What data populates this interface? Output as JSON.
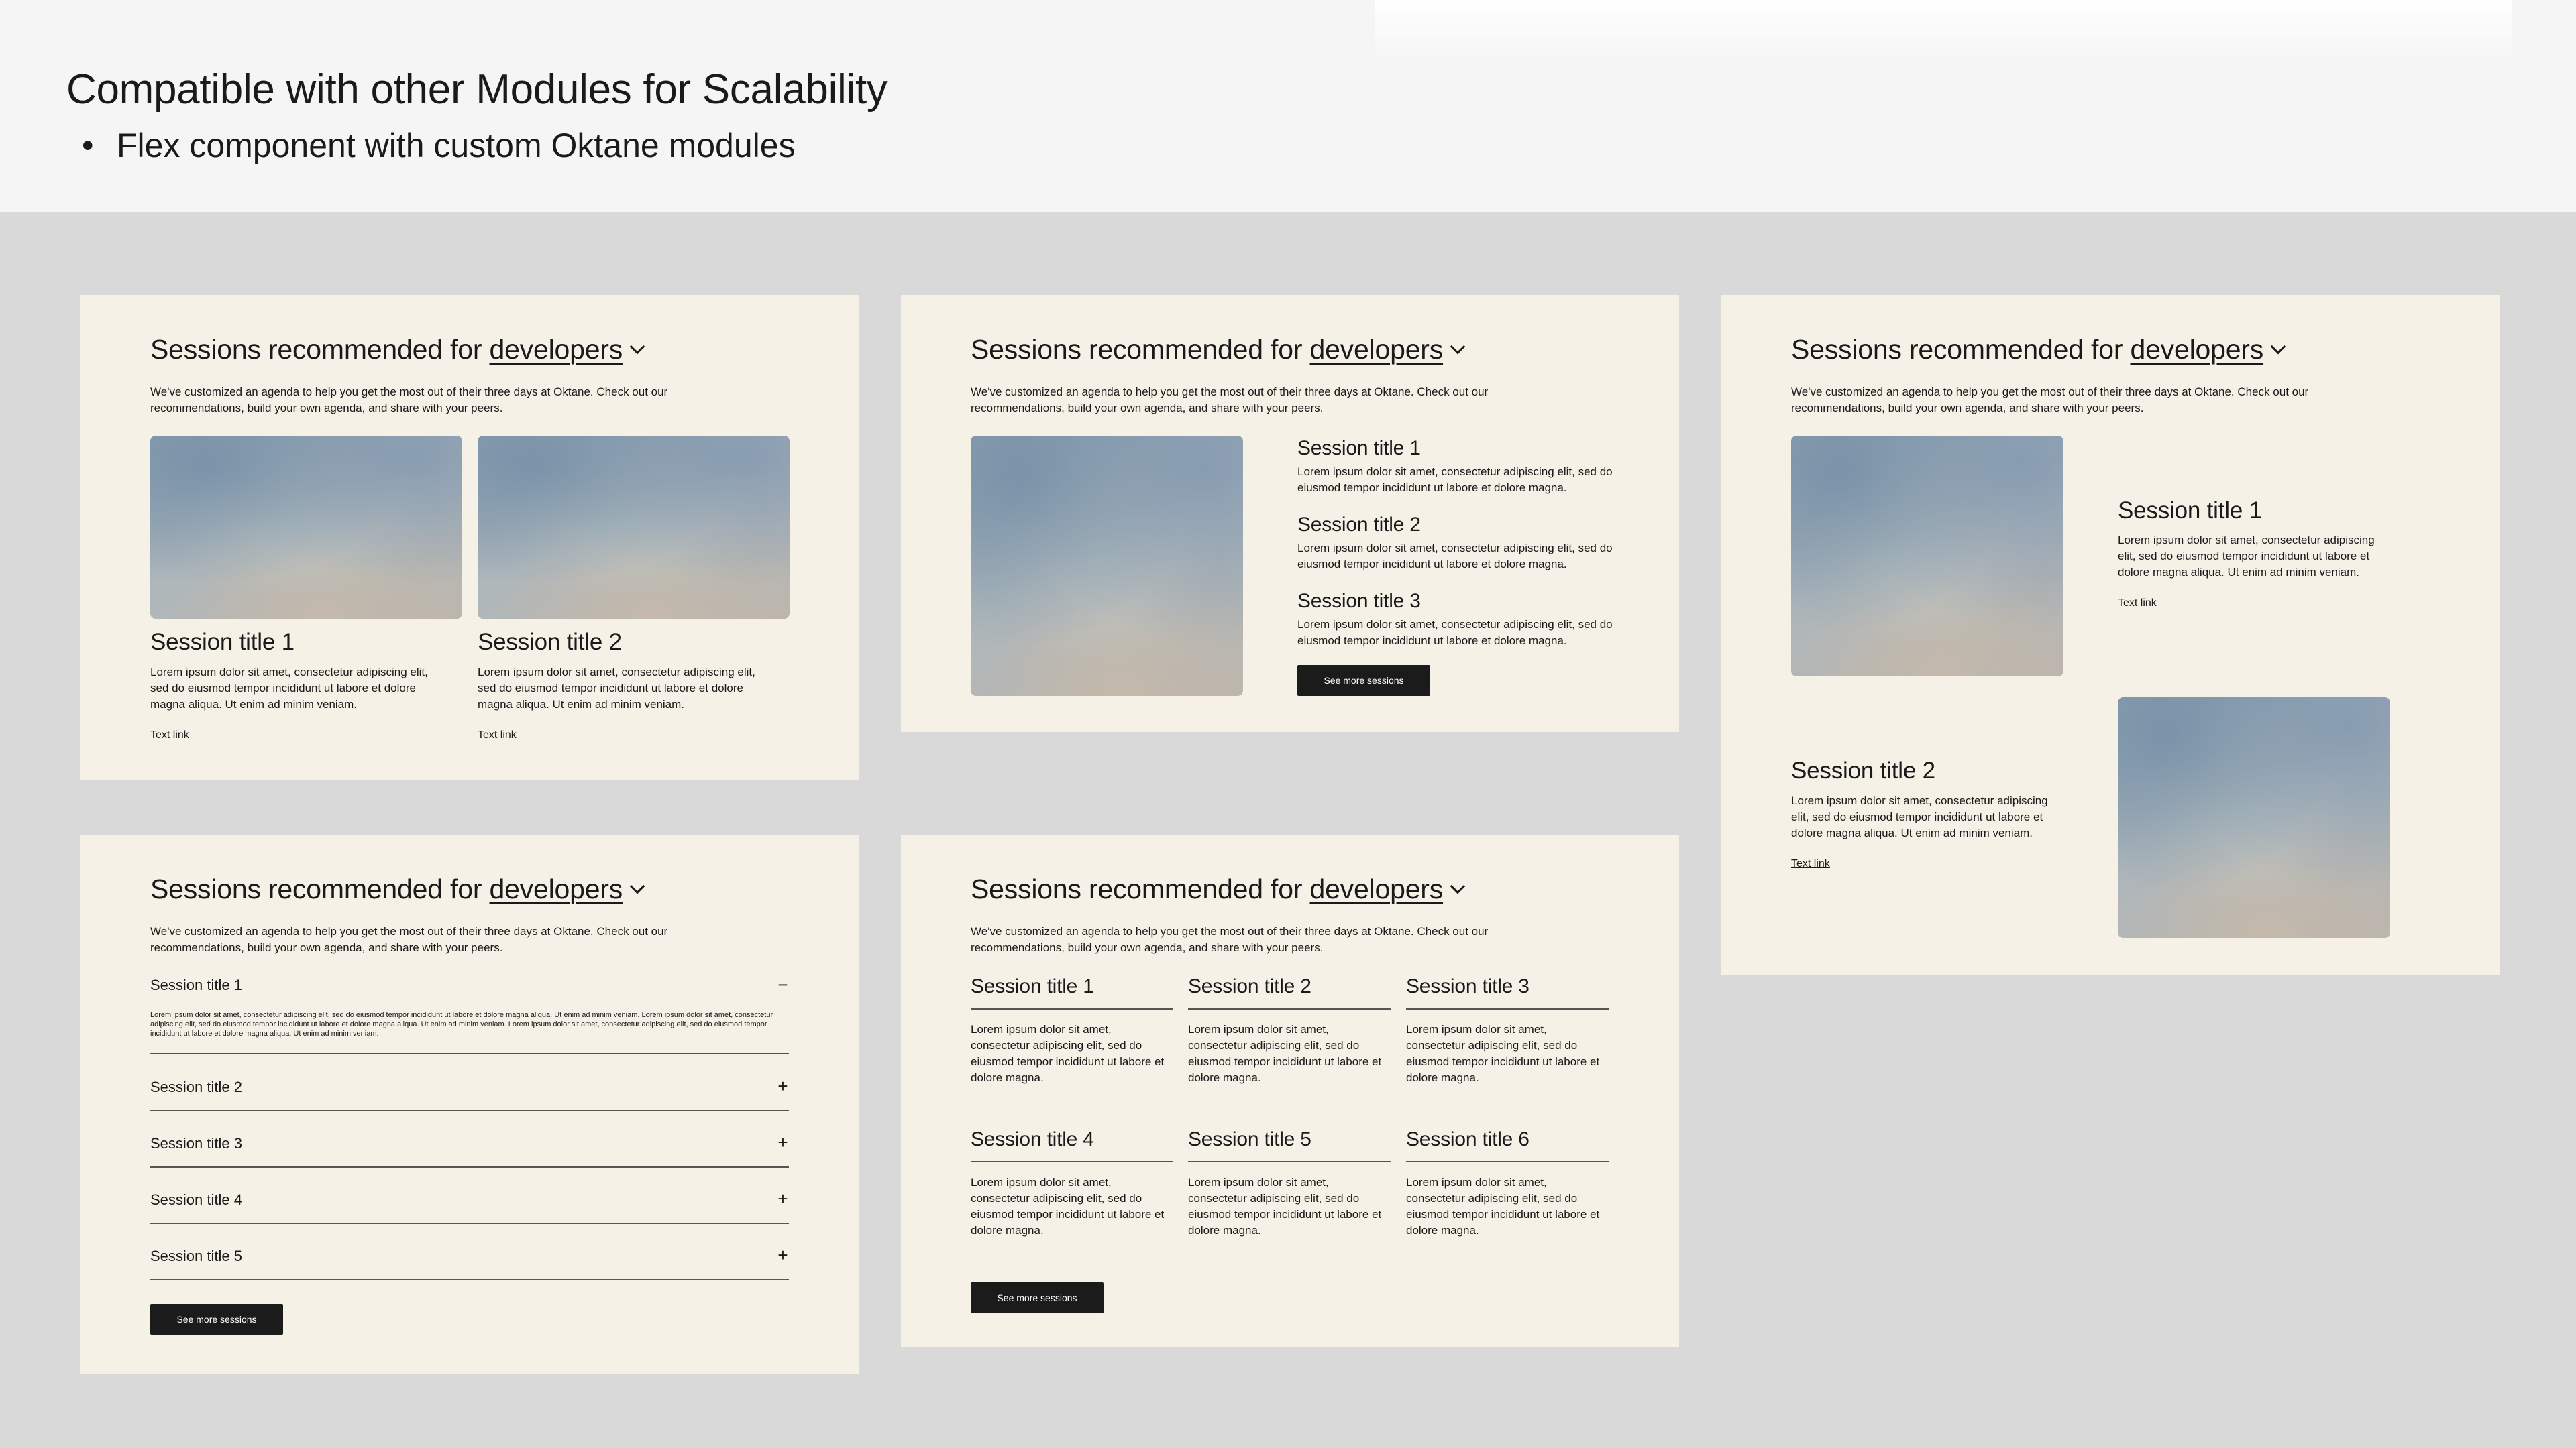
{
  "header": {
    "title": "Compatible with other Modules for Scalability",
    "bullet": "Flex component with custom Oktane modules"
  },
  "card_common": {
    "title_prefix": "Sessions recommended for ",
    "title_highlight": "developers",
    "description": "We've customized an agenda to help you get the most out of their three days at Oktane. Check out our recommendations, build your own agenda, and share with your peers.",
    "lorem_short": "Lorem ipsum dolor sit amet, consectetur adipiscing elit, sed do eiusmod tempor incididunt ut labore et dolore magna.",
    "lorem_medium": "Lorem ipsum dolor sit amet, consectetur adipiscing elit, sed do eiusmod tempor incididunt ut labore et dolore magna aliqua. Ut enim ad minim veniam.",
    "lorem_long": "Lorem ipsum dolor sit amet, consectetur adipiscing elit, sed do eiusmod tempor incididunt ut labore et dolore magna aliqua. Ut enim ad minim veniam. Lorem ipsum dolor sit amet, consectetur adipiscing elit, sed do eiusmod tempor incididunt ut labore et dolore magna aliqua. Ut enim ad minim veniam. Lorem ipsum dolor sit amet, consectetur adipiscing elit, sed do eiusmod tempor incididunt ut labore et dolore magna aliqua. Ut enim ad minim veniam.",
    "text_link": "Text link",
    "see_more": "See more sessions"
  },
  "sessions": {
    "s1": "Session title 1",
    "s2": "Session title 2",
    "s3": "Session title 3",
    "s4": "Session title 4",
    "s5": "Session title 5",
    "s6": "Session title 6"
  },
  "accordion": {
    "open_icon": "minus-icon",
    "closed_icon": "plus-icon"
  },
  "icons": {
    "dropdown": "chevron-down-icon"
  }
}
